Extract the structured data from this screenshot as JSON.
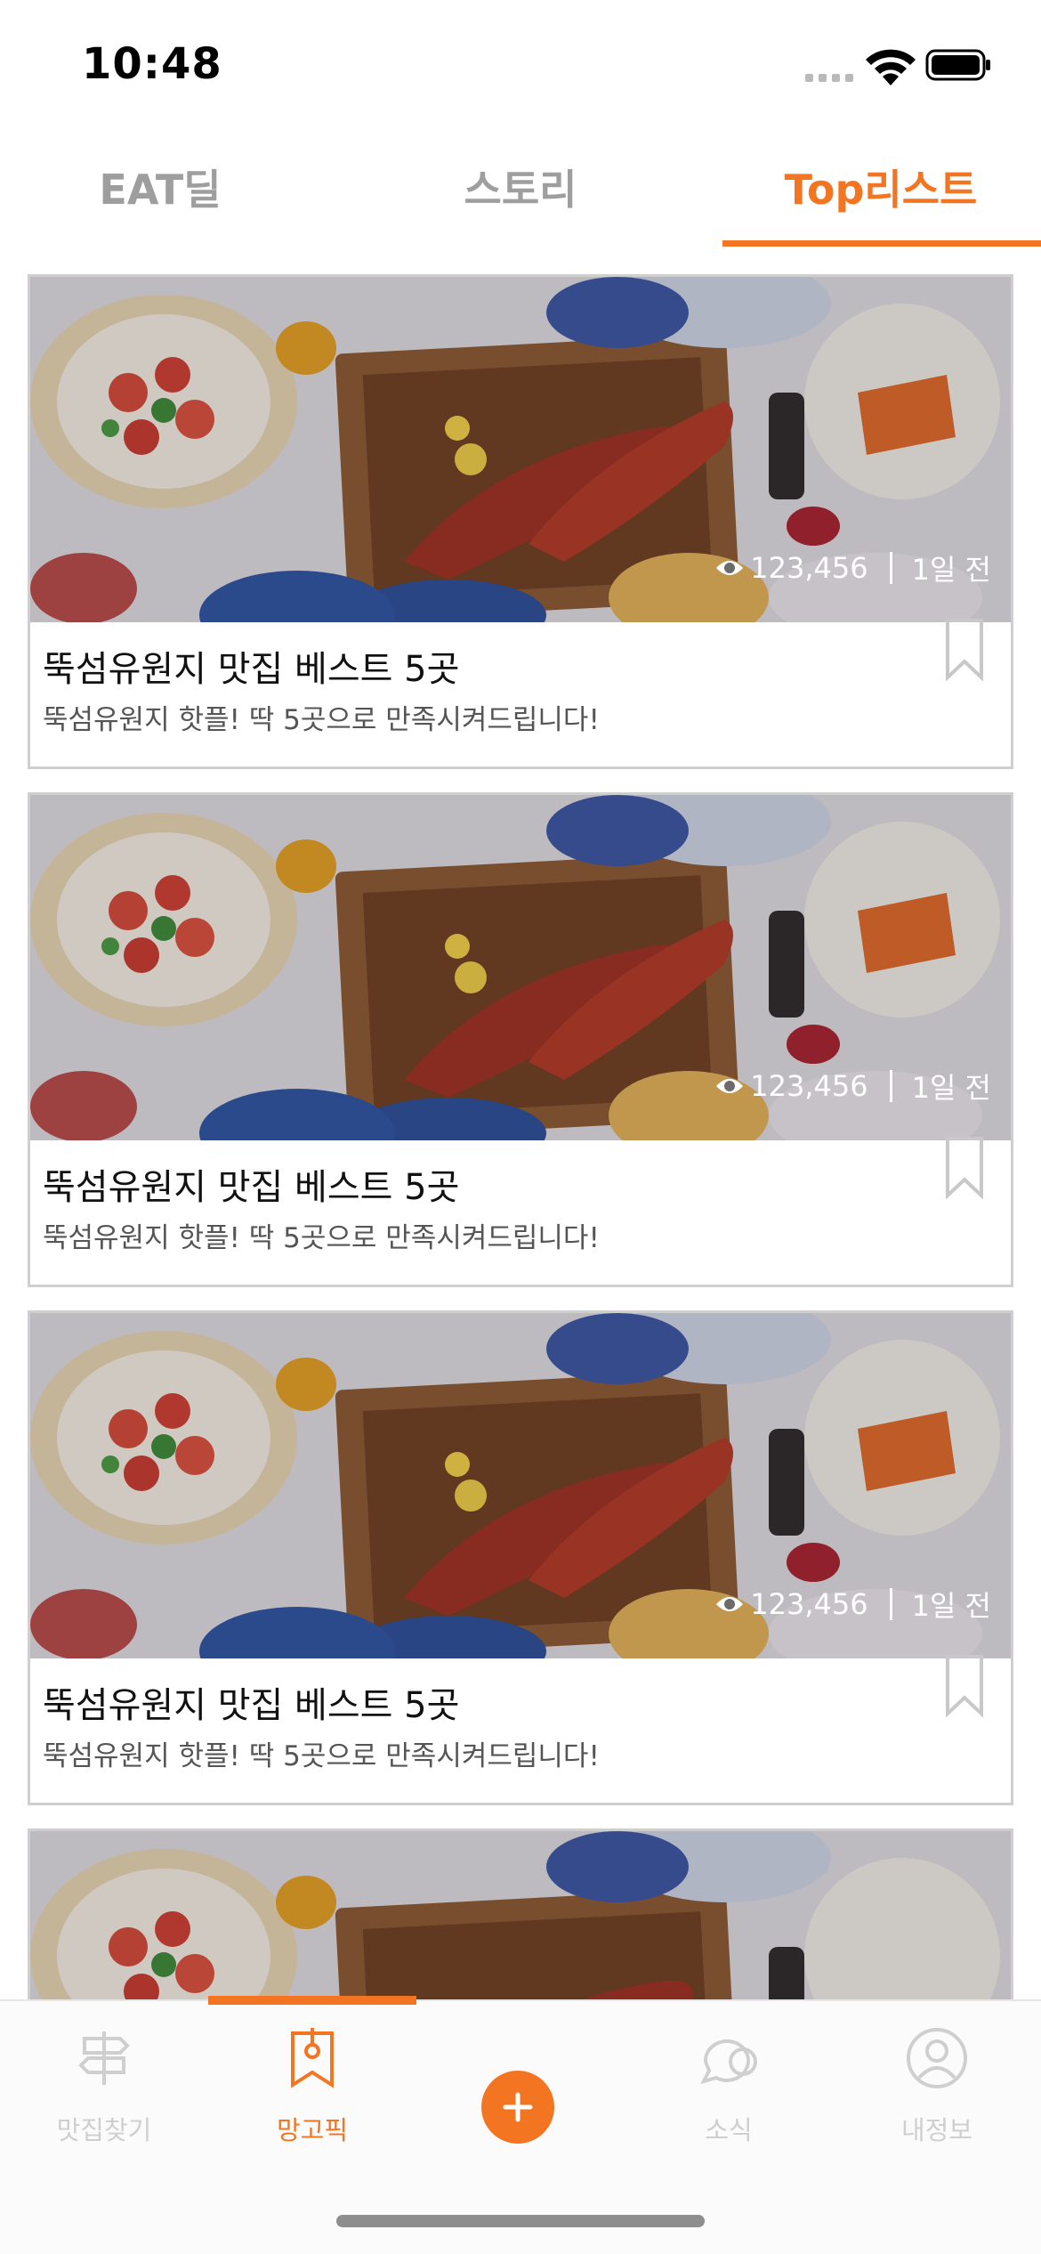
{
  "status_bar": {
    "time": "10:48"
  },
  "top_tabs": [
    {
      "label": "EAT딜",
      "active": false
    },
    {
      "label": "스토리",
      "active": false
    },
    {
      "label": "Top리스트",
      "active": true
    }
  ],
  "cards": [
    {
      "views": "123,456",
      "time_ago": "1일 전",
      "title": "뚝섬유원지 맛집 베스트 5곳",
      "subtitle": "뚝섬유원지 핫플! 딱 5곳으로 만족시켜드립니다!"
    },
    {
      "views": "123,456",
      "time_ago": "1일 전",
      "title": "뚝섬유원지 맛집 베스트 5곳",
      "subtitle": "뚝섬유원지 핫플! 딱 5곳으로 만족시켜드립니다!"
    },
    {
      "views": "123,456",
      "time_ago": "1일 전",
      "title": "뚝섬유원지 맛집 베스트 5곳",
      "subtitle": "뚝섬유원지 핫플! 딱 5곳으로 만족시켜드립니다!"
    },
    {
      "views": "",
      "time_ago": "",
      "title": "",
      "subtitle": ""
    }
  ],
  "bottom_nav": [
    {
      "label": "맛집찾기",
      "icon": "signpost-icon",
      "active": false
    },
    {
      "label": "망고픽",
      "icon": "bookmark-pin-icon",
      "active": true
    },
    {
      "label": "",
      "icon": "plus-icon",
      "active": false
    },
    {
      "label": "소식",
      "icon": "chat-bubble-icon",
      "active": false
    },
    {
      "label": "내정보",
      "icon": "profile-icon",
      "active": false
    }
  ],
  "colors": {
    "accent": "#f47521",
    "inactive": "#9e9e9e",
    "nav_inactive": "#cfcfcf"
  }
}
